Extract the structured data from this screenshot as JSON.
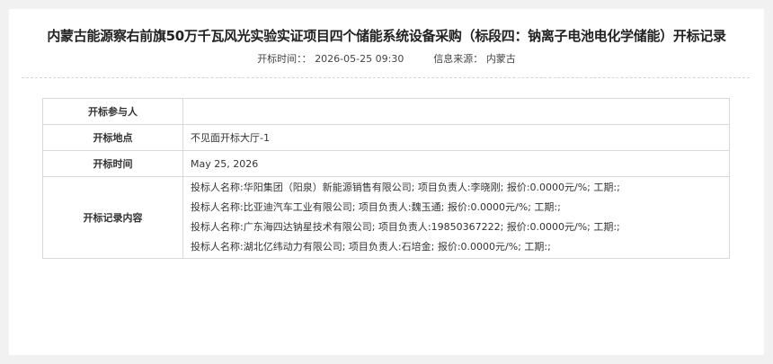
{
  "header": {
    "title": "内蒙古能源察右前旗50万千瓦风光实验实证项目四个储能系统设备采购（标段四：钠离子电池电化学储能）开标记录",
    "time_label": "开标时间：：",
    "time_value": "2026-05-25 09:30",
    "source_label": "信息来源：",
    "source_value": "内蒙古"
  },
  "table": {
    "rows": [
      {
        "label": "开标参与人",
        "value": ""
      },
      {
        "label": "开标地点",
        "value": "不见面开标大厅-1"
      },
      {
        "label": "开标时间",
        "value": "May 25, 2026"
      }
    ],
    "records_label": "开标记录内容",
    "bidders": [
      "投标人名称:华阳集团（阳泉）新能源销售有限公司; 项目负责人:李晓刚; 报价:0.0000元/%; 工期:;",
      "投标人名称:比亚迪汽车工业有限公司; 项目负责人:魏玉通; 报价:0.0000元/%; 工期:;",
      "投标人名称:广东海四达钠星技术有限公司; 项目负责人:19850367222; 报价:0.0000元/%; 工期:;",
      "投标人名称:湖北亿纬动力有限公司; 项目负责人:石培金; 报价:0.0000元/%; 工期:;"
    ]
  }
}
